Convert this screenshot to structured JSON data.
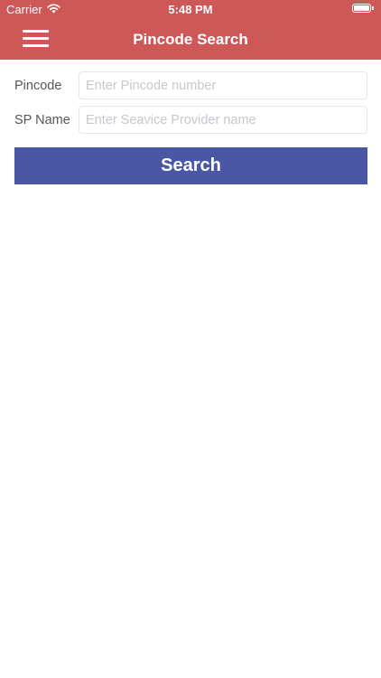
{
  "status_bar": {
    "carrier": "Carrier",
    "time": "5:48 PM",
    "battery_level": 1.0,
    "icons": [
      "wifi-icon",
      "battery-icon"
    ]
  },
  "nav": {
    "title": "Pincode Search",
    "menu_icon": "hamburger-menu-icon"
  },
  "form": {
    "pincode": {
      "label": "Pincode",
      "value": "",
      "placeholder": "Enter Pincode number"
    },
    "sp_name": {
      "label": "SP Name",
      "value": "",
      "placeholder": "Enter Seavice Provider name"
    },
    "search_label": "Search"
  },
  "colors": {
    "header": "#ce5757",
    "button": "#4a56a6",
    "background": "#ffffff",
    "placeholder": "#c7c7cd"
  }
}
